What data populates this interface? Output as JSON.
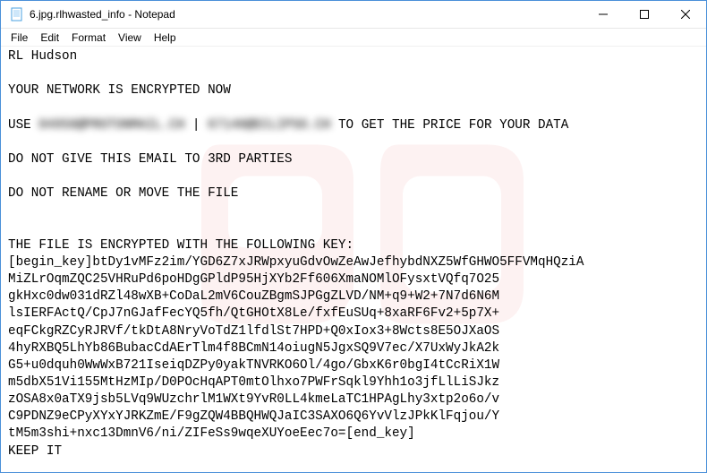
{
  "window": {
    "title": "6.jpg.rlhwasted_info - Notepad",
    "app_icon": "notepad-icon"
  },
  "controls": {
    "minimize": "—",
    "maximize": "☐",
    "close": "✕"
  },
  "menu": {
    "file": "File",
    "edit": "Edit",
    "format": "Format",
    "view": "View",
    "help": "Help"
  },
  "body": {
    "line_rl": "RL Hudson",
    "line_net": "YOUR NETWORK IS ENCRYPTED NOW",
    "line_use_pre": "USE ",
    "line_use_redact1": "04950@PROTONMAIL.CH",
    "line_use_sep": " | ",
    "line_use_redact2": "67140@ECLIPSO.CH",
    "line_use_post": " TO GET THE PRICE FOR YOUR DATA",
    "line_3rd": "DO NOT GIVE THIS EMAIL TO 3RD PARTIES",
    "line_rename": "DO NOT RENAME OR MOVE THE FILE",
    "line_key_hdr": "THE FILE IS ENCRYPTED WITH THE FOLLOWING KEY:",
    "key_01": "[begin_key]btDy1vMFz2im/YGD6Z7xJRWpxyuGdvOwZeAwJefhybdNXZ5WfGHWO5FFVMqHQziA",
    "key_02": "MiZLrOqmZQC25VHRuPd6poHDgGPldP95HjXYb2Ff606XmaNOMlOFysxtVQfq7O25",
    "key_03": "gkHxc0dw031dRZl48wXB+CoDaL2mV6CouZBgmSJPGgZLVD/NM+q9+W2+7N7d6N6M",
    "key_04": "lsIERFActQ/CpJ7nGJafFecYQ5fh/QtGHOtX8Le/fxfEuSUq+8xaRF6Fv2+5p7X+",
    "key_05": "eqFCkgRZCyRJRVf/tkDtA8NryVoTdZ1lfdlSt7HPD+Q0xIox3+8Wcts8E5OJXaOS",
    "key_06": "4hyRXBQ5LhYb86BubacCdAErTlm4f8BCmN14oiugN5JgxSQ9V7ec/X7UxWyJkA2k",
    "key_07": "G5+u0dquh0WwWxB721IseiqDZPy0yakTNVRKO6Ol/4go/GbxK6r0bgI4tCcRiX1W",
    "key_08": "m5dbX51Vi155MtHzMIp/D0POcHqAPT0mtOlhxo7PWFrSqkl9Yhh1o3jfLlLiSJkz",
    "key_09": "zOSA8x0aTX9jsb5LVq9WUzchrlM1WXt9YvR0LL4kmeLaTC1HPAgLhy3xtp2o6o/v",
    "key_10": "C9PDNZ9eCPyXYxYJRKZmE/F9gZQW4BBQHWQJaIC3SAXO6Q6YvVlzJPkKlFqjou/Y",
    "key_11": "tM5m3shi+nxc13DmnV6/ni/ZIFeSs9wqeXUYoeEec7o=[end_key]",
    "line_keep": "KEEP IT"
  }
}
